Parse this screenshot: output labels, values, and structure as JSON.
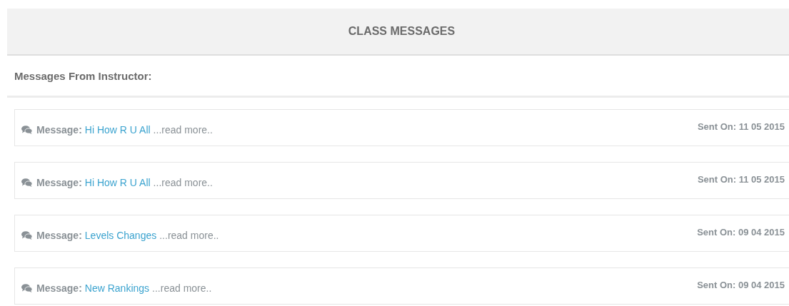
{
  "header": {
    "title": "CLASS MESSAGES"
  },
  "section": {
    "title": "Messages From Instructor:"
  },
  "messages": [
    {
      "label": "Message:",
      "title": "Hi How R U All",
      "more": "...read more..",
      "sent": "Sent On: 11 05 2015"
    },
    {
      "label": "Message:",
      "title": "Hi How R U All",
      "more": "...read more..",
      "sent": "Sent On: 11 05 2015"
    },
    {
      "label": "Message:",
      "title": "Levels Changes",
      "more": "...read more..",
      "sent": "Sent On: 09 04 2015"
    },
    {
      "label": "Message:",
      "title": "New Rankings",
      "more": "...read more..",
      "sent": "Sent On: 09 04 2015"
    }
  ]
}
